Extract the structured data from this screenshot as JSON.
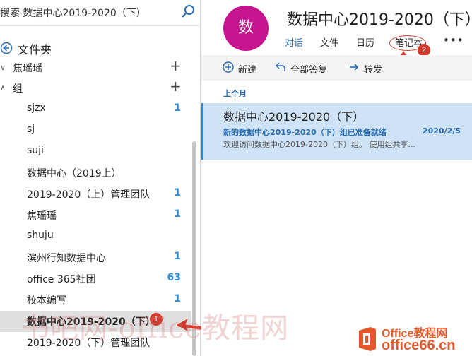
{
  "sidebar": {
    "search_text": "搜索 数据中心2019-2020（下）",
    "folder_title": "文件夹",
    "groups": [
      {
        "label": "焦瑶瑶",
        "collapsed": true
      },
      {
        "label": "组",
        "collapsed": false
      }
    ],
    "items": [
      {
        "name": "sjzx",
        "count": "1"
      },
      {
        "name": "sj",
        "count": ""
      },
      {
        "name": "suji",
        "count": ""
      },
      {
        "name": "数据中心（2019上）",
        "count": ""
      },
      {
        "name": "2019-2020（上）管理团队",
        "count": "1"
      },
      {
        "name": "焦瑶瑶",
        "count": "1"
      },
      {
        "name": "shuju",
        "count": ""
      },
      {
        "name": "滨州行知数据中心",
        "count": "1"
      },
      {
        "name": "office 365社团",
        "count": "63"
      },
      {
        "name": "校本编写",
        "count": "1"
      },
      {
        "name": "数据中心2019-2020（下）",
        "count": "",
        "selected": true
      },
      {
        "name": "2019-2020（下）管理团队",
        "count": ""
      }
    ]
  },
  "header": {
    "avatar_char": "数",
    "title": "数据中心2019-2020（下）",
    "tabs": [
      {
        "label": "对话",
        "active": true
      },
      {
        "label": "文件"
      },
      {
        "label": "日历"
      },
      {
        "label": "笔记本"
      }
    ]
  },
  "commands": {
    "new": "新建",
    "reply_all": "全部答复",
    "forward": "转发"
  },
  "messages": {
    "section_label": "上个月",
    "items": [
      {
        "title": "数据中心2019-2020（下）",
        "subtitle": "新的数据中心2019-2020（下）组已准备就绪",
        "date": "2020/2/5",
        "preview": "欢迎访问数据中心2019-2020（下）组。 使用组共享..."
      }
    ]
  },
  "annotations": {
    "badge1": "1",
    "badge2": "2"
  },
  "watermark": {
    "text": "书吧网-office教程网",
    "logo_line1": "Office教程网",
    "logo_line2": "office66.cn"
  },
  "colors": {
    "accent": "#2b88d8",
    "avatar": "#c6148f",
    "selected_row": "#cfe3f6",
    "annotation": "#d33a2c"
  }
}
